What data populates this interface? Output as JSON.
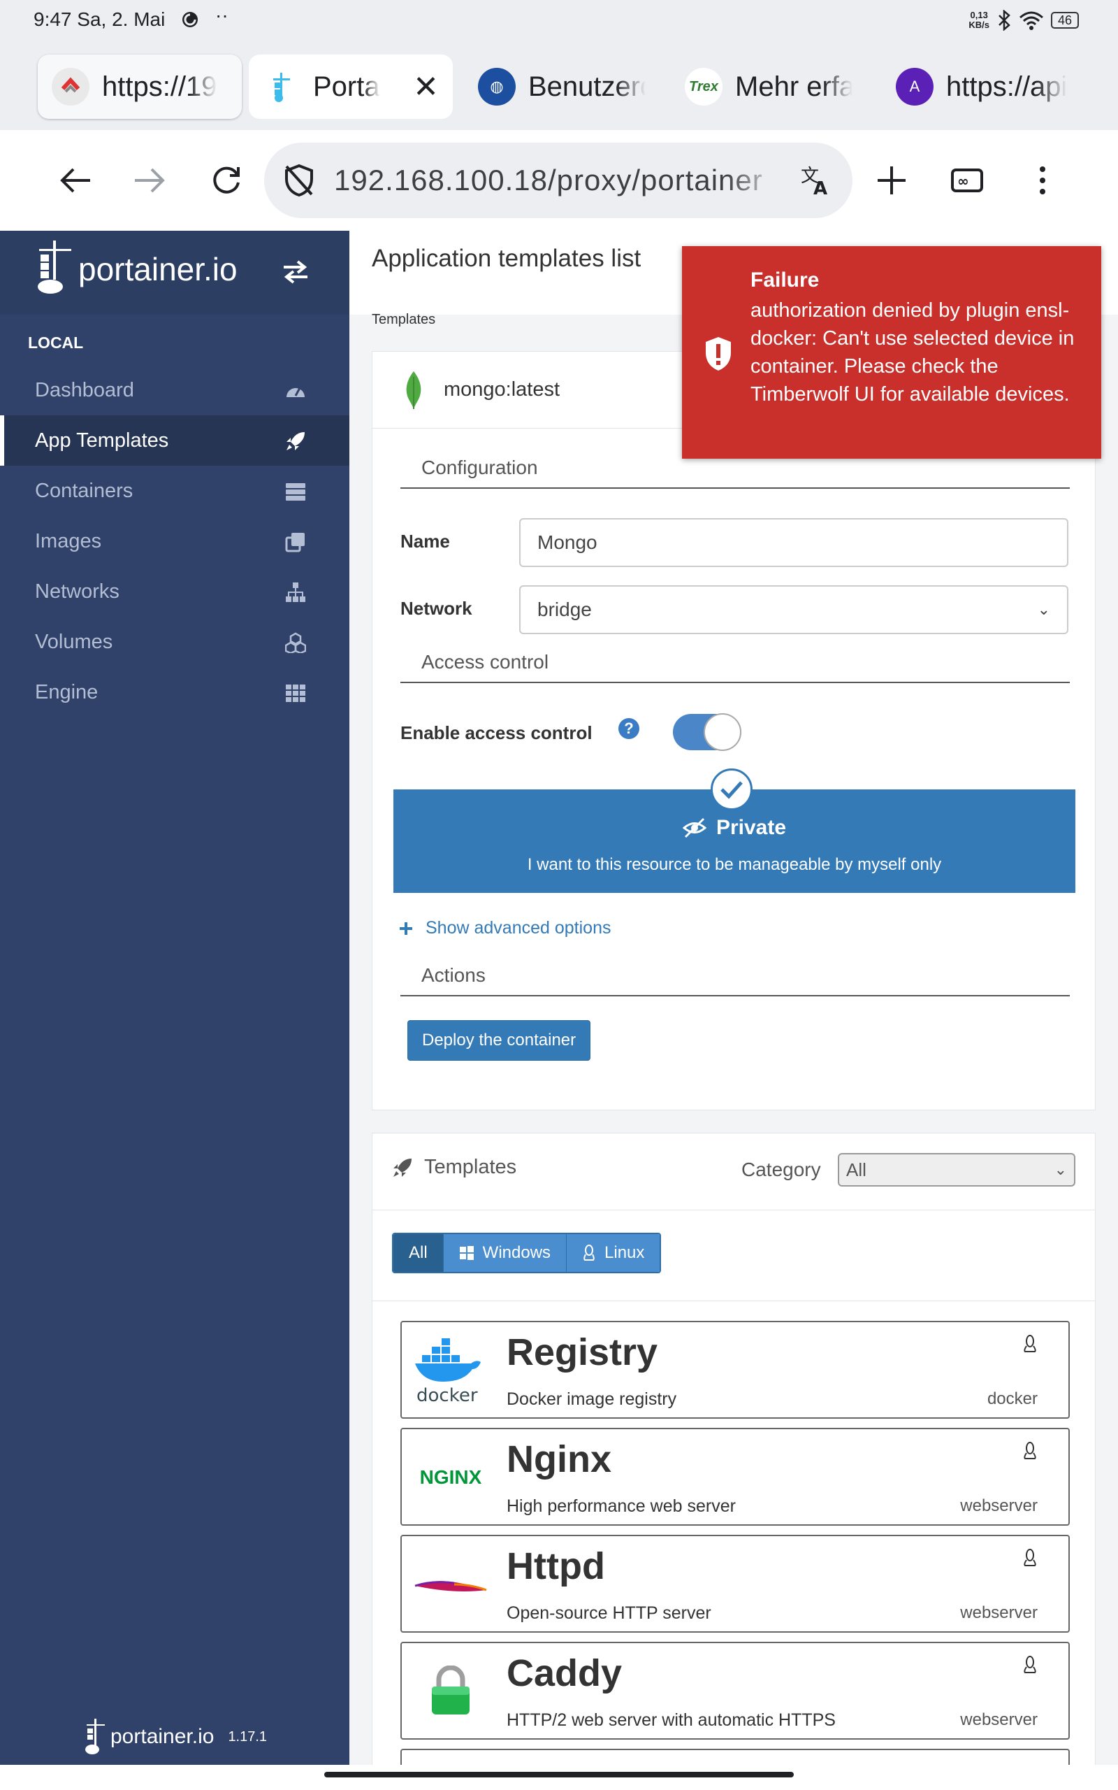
{
  "status_bar": {
    "time": "9:47 Sa, 2. Mai",
    "net_speed_value": "0,13",
    "net_speed_unit": "KB/s",
    "battery": "46"
  },
  "tabs": [
    {
      "title": "https://19",
      "favicon": "red-circle-favicon"
    },
    {
      "title": "Porta",
      "favicon": "portainer-favicon",
      "active": true
    },
    {
      "title": "Benutzerd",
      "favicon": "blue-globe-favicon"
    },
    {
      "title": "Mehr erfal",
      "favicon": "trex-favicon",
      "favicon_text": "Trex"
    },
    {
      "title": "https://api",
      "favicon": "purple-avatar-favicon",
      "favicon_text": "A"
    }
  ],
  "address_bar": {
    "url": "192.168.100.18/proxy/portainer"
  },
  "sidebar": {
    "brand": "portainer.io",
    "section": "LOCAL",
    "items": [
      {
        "label": "Dashboard",
        "icon": "tachometer-icon"
      },
      {
        "label": "App Templates",
        "icon": "rocket-icon",
        "active": true
      },
      {
        "label": "Containers",
        "icon": "server-icon"
      },
      {
        "label": "Images",
        "icon": "clone-icon"
      },
      {
        "label": "Networks",
        "icon": "sitemap-icon"
      },
      {
        "label": "Volumes",
        "icon": "cubes-icon"
      },
      {
        "label": "Engine",
        "icon": "th-icon"
      }
    ],
    "footer_brand": "portainer.io",
    "version": "1.17.1"
  },
  "header": {
    "title": "Application templates list",
    "breadcrumb": "Templates"
  },
  "selected_template": {
    "name": "mongo:latest",
    "config_section": "Configuration",
    "name_label": "Name",
    "name_value": "Mongo",
    "network_label": "Network",
    "network_value": "bridge",
    "access_section": "Access control",
    "access_toggle_label": "Enable access control",
    "access_enabled": true,
    "private_title": "Private",
    "private_desc": "I want to this resource to be manageable by myself only",
    "advanced_link": "Show advanced options",
    "actions_section": "Actions",
    "deploy_label": "Deploy the container"
  },
  "templates": {
    "title": "Templates",
    "category_label": "Category",
    "category_value": "All",
    "filters": [
      "All",
      "Windows",
      "Linux"
    ],
    "active_filter": "All",
    "items": [
      {
        "name": "Registry",
        "description": "Docker image registry",
        "category": "docker",
        "logo": "docker-logo",
        "logo_text": "docker"
      },
      {
        "name": "Nginx",
        "description": "High performance web server",
        "category": "webserver",
        "logo": "nginx-logo",
        "logo_text": "NGINX"
      },
      {
        "name": "Httpd",
        "description": "Open-source HTTP server",
        "category": "webserver",
        "logo": "apache-feather-logo"
      },
      {
        "name": "Caddy",
        "description": "HTTP/2 web server with automatic HTTPS",
        "category": "webserver",
        "logo": "green-lock-logo"
      }
    ]
  },
  "toast": {
    "title": "Failure",
    "message": "authorization denied by plugin ensl-docker: Can't use selected device in container. Please check the Timberwolf UI for available devices."
  },
  "colors": {
    "sidebar_bg": "#30426a",
    "primary": "#337ab7",
    "toast_bg": "#c9302c"
  }
}
